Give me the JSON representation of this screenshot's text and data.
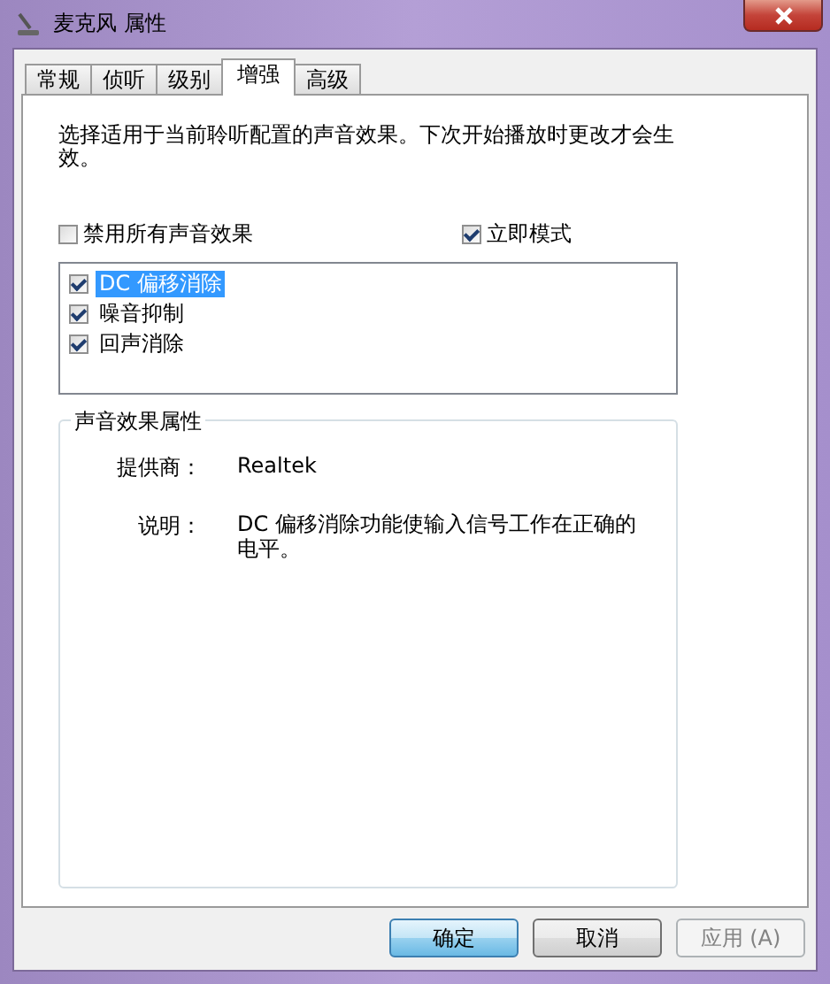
{
  "window": {
    "title": "麦克风 属性"
  },
  "tabs": [
    {
      "label": "常规",
      "selected": false
    },
    {
      "label": "侦听",
      "selected": false
    },
    {
      "label": "级别",
      "selected": false
    },
    {
      "label": "增强",
      "selected": true
    },
    {
      "label": "高级",
      "selected": false
    }
  ],
  "description": "选择适用于当前聆听配置的声音效果。下次开始播放时更改才会生效。",
  "options": [
    {
      "label": "禁用所有声音效果",
      "checked": false
    },
    {
      "label": "立即模式",
      "checked": true
    }
  ],
  "effects": [
    {
      "label": "DC 偏移消除",
      "checked": true,
      "selected": true
    },
    {
      "label": "噪音抑制",
      "checked": true,
      "selected": false
    },
    {
      "label": "回声消除",
      "checked": true,
      "selected": false
    }
  ],
  "properties": {
    "title": "声音效果属性",
    "rows": [
      {
        "label": "提供商：",
        "value": "Realtek"
      },
      {
        "label": "说明：",
        "value": "DC 偏移消除功能使输入信号工作在正确的电平。"
      }
    ]
  },
  "buttons": [
    {
      "label": "确定",
      "kind": "default",
      "disabled": false
    },
    {
      "label": "取消",
      "kind": "normal",
      "disabled": false
    },
    {
      "label": "应用 (A)",
      "kind": "normal",
      "disabled": true
    }
  ]
}
